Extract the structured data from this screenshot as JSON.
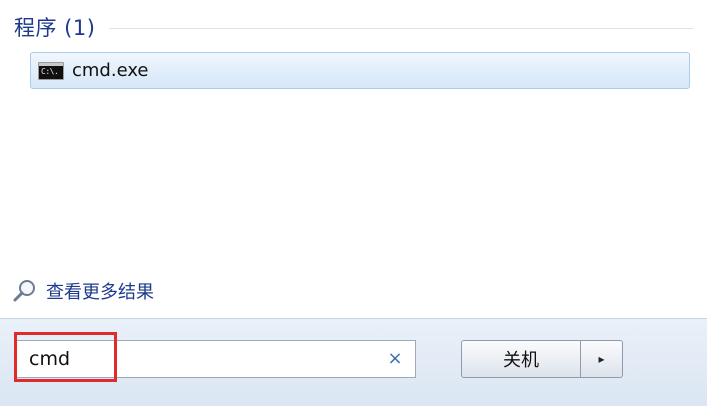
{
  "programs": {
    "group_title": "程序 (1)",
    "items": [
      {
        "label": "cmd.exe",
        "icon": "command-prompt-icon",
        "icon_text": "C:\\."
      }
    ]
  },
  "more_results": {
    "label": "查看更多结果",
    "icon": "search-icon"
  },
  "search": {
    "value": "cmd",
    "clear_symbol": "×"
  },
  "shutdown": {
    "label": "关机",
    "arrow": "▸"
  },
  "colors": {
    "accent_text": "#1e3a8c",
    "selection_border": "#a9cbec",
    "highlight_annotation": "#e12b2b"
  }
}
